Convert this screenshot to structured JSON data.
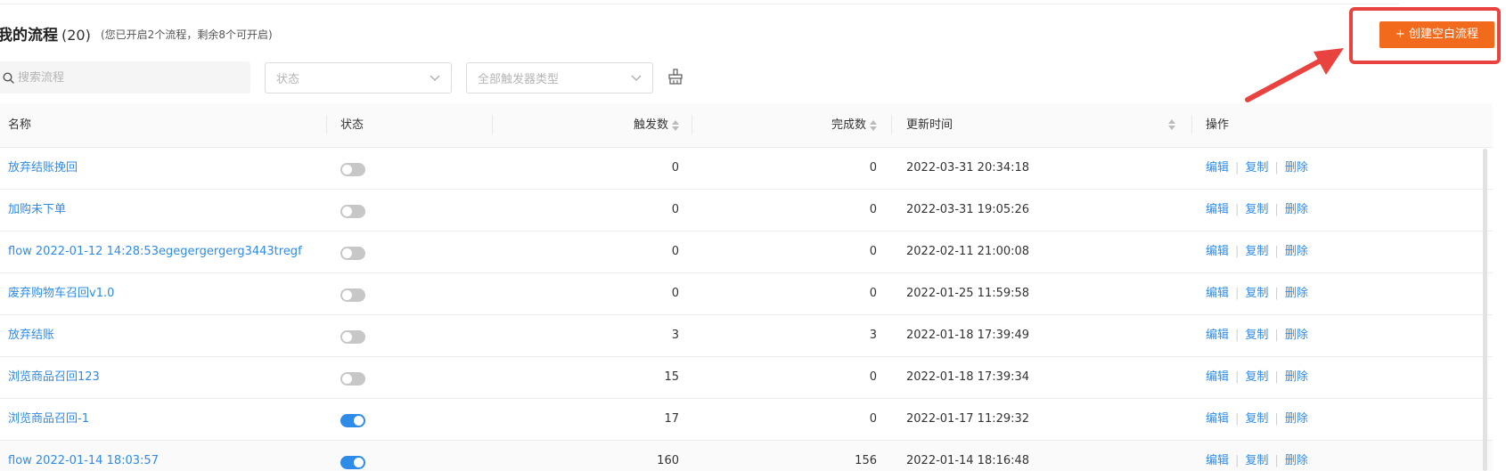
{
  "header": {
    "title": "我的流程",
    "count": "(20)",
    "hint": "(您已开启2个流程，剩余8个可开启)",
    "create_button": "+ 创建空白流程"
  },
  "filters": {
    "search_placeholder": "搜索流程",
    "status_placeholder": "状态",
    "trigger_placeholder": "全部触发器类型"
  },
  "table": {
    "columns": {
      "name": "名称",
      "status": "状态",
      "triggers": "触发数",
      "completed": "完成数",
      "updated": "更新时间",
      "actions": "操作"
    },
    "action_labels": {
      "edit": "编辑",
      "copy": "复制",
      "delete": "删除"
    },
    "rows": [
      {
        "name": "放弃结账挽回",
        "enabled": false,
        "triggers": "0",
        "completed": "0",
        "updated": "2022-03-31 20:34:18"
      },
      {
        "name": "加购未下单",
        "enabled": false,
        "triggers": "0",
        "completed": "0",
        "updated": "2022-03-31 19:05:26"
      },
      {
        "name": "flow 2022-01-12 14:28:53egegergergerg3443tregf",
        "enabled": false,
        "triggers": "0",
        "completed": "0",
        "updated": "2022-02-11 21:00:08"
      },
      {
        "name": "废弃购物车召回v1.0",
        "enabled": false,
        "triggers": "0",
        "completed": "0",
        "updated": "2022-01-25 11:59:58"
      },
      {
        "name": "放弃结账",
        "enabled": false,
        "triggers": "3",
        "completed": "3",
        "updated": "2022-01-18 17:39:49"
      },
      {
        "name": "浏览商品召回123",
        "enabled": false,
        "triggers": "15",
        "completed": "0",
        "updated": "2022-01-18 17:39:34"
      },
      {
        "name": "浏览商品召回-1",
        "enabled": true,
        "triggers": "17",
        "completed": "0",
        "updated": "2022-01-17 11:29:32"
      },
      {
        "name": "flow 2022-01-14 18:03:57",
        "enabled": true,
        "triggers": "160",
        "completed": "156",
        "updated": "2022-01-14 18:16:48"
      }
    ]
  },
  "colors": {
    "accent": "#f26b1d",
    "link": "#2e8be6",
    "annotation": "#e8433e"
  }
}
